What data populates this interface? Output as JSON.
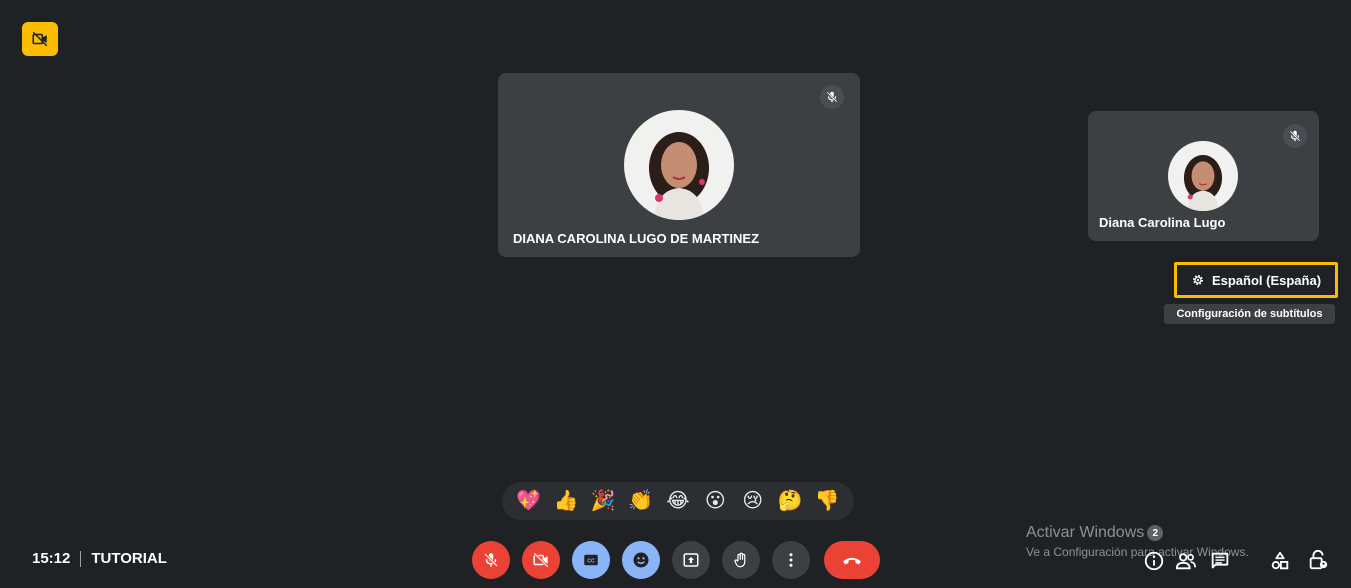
{
  "top_badge": {
    "icon": "video-off-icon",
    "color": "#fbbc04"
  },
  "participants": [
    {
      "name": "DIANA CAROLINA LUGO DE MARTINEZ",
      "muted": true
    },
    {
      "name": "Diana Carolina Lugo",
      "muted": true
    }
  ],
  "captions": {
    "language": "Español (España)",
    "tooltip": "Configuración de subtítulos"
  },
  "reactions": [
    "💖",
    "👍",
    "🎉",
    "👏",
    "😂",
    "😮",
    "😢",
    "🤔",
    "👎"
  ],
  "meeting": {
    "time": "15:12",
    "title": "TUTORIAL"
  },
  "controls": [
    {
      "name": "microphone-toggle",
      "icon": "mic-off-icon",
      "state": "off"
    },
    {
      "name": "camera-toggle",
      "icon": "camera-off-icon",
      "state": "off"
    },
    {
      "name": "captions-toggle",
      "icon": "cc-icon",
      "state": "on"
    },
    {
      "name": "reactions-toggle",
      "icon": "emoji-icon",
      "state": "on"
    },
    {
      "name": "present-button",
      "icon": "present-icon"
    },
    {
      "name": "raise-hand-button",
      "icon": "hand-icon"
    },
    {
      "name": "more-options-button",
      "icon": "more-vert-icon"
    },
    {
      "name": "leave-call-button",
      "icon": "phone-hangup-icon"
    }
  ],
  "side_panel": {
    "people_count": "2"
  },
  "watermark": {
    "title": "Activar Windows",
    "subtitle": "Ve a Configuración para activar Windows."
  },
  "colors": {
    "background": "#202124",
    "tile": "#3c4043",
    "highlight": "#fbbc04",
    "danger": "#ea4335",
    "active": "#8ab4f8"
  }
}
